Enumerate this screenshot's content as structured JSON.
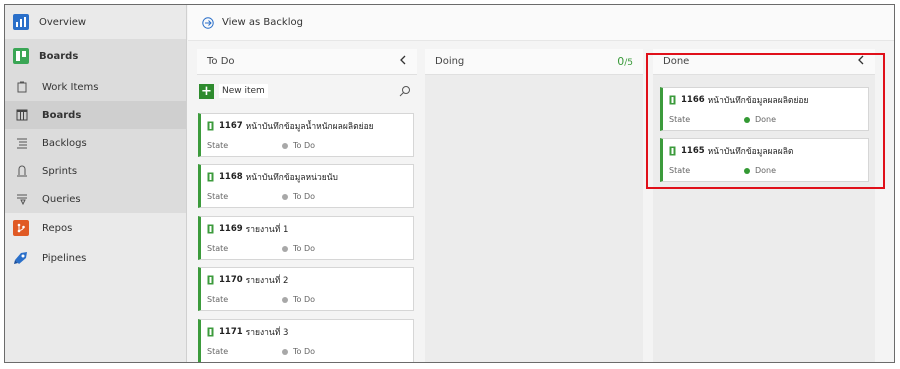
{
  "sidebar": {
    "items": [
      {
        "label": "Overview"
      },
      {
        "label": "Boards"
      },
      {
        "label": "Work Items"
      },
      {
        "label": "Boards"
      },
      {
        "label": "Backlogs"
      },
      {
        "label": "Sprints"
      },
      {
        "label": "Queries"
      },
      {
        "label": "Repos"
      },
      {
        "label": "Pipelines"
      }
    ]
  },
  "topbar": {
    "view_backlog": "View as Backlog"
  },
  "columns": {
    "todo": {
      "title": "To Do",
      "new_item": "New item"
    },
    "doing": {
      "title": "Doing",
      "wip": "0",
      "wip_limit": "/5"
    },
    "done": {
      "title": "Done"
    }
  },
  "cards": {
    "todo": [
      {
        "id": "1167",
        "title": "หน้าบันทึกข้อมูลน้ำหนักผลผลิตย่อย",
        "state_label": "State",
        "state": "To Do"
      },
      {
        "id": "1168",
        "title": "หน้าบันทึกข้อมูลหน่วยนับ",
        "state_label": "State",
        "state": "To Do"
      },
      {
        "id": "1169",
        "title": "รายงานที่ 1",
        "state_label": "State",
        "state": "To Do"
      },
      {
        "id": "1170",
        "title": "รายงานที่ 2",
        "state_label": "State",
        "state": "To Do"
      },
      {
        "id": "1171",
        "title": "รายงานที่ 3",
        "state_label": "State",
        "state": "To Do"
      }
    ],
    "done": [
      {
        "id": "1166",
        "title": "หน้าบันทึกข้อมูลผลผลิตย่อย",
        "state_label": "State",
        "state": "Done"
      },
      {
        "id": "1165",
        "title": "หน้าบันทึกข้อมูลผลผลิต",
        "state_label": "State",
        "state": "Done"
      }
    ]
  },
  "colors": {
    "accent_green": "#3c9b3c",
    "highlight_red": "#e0101a",
    "todo_dot": "#a8a8a8",
    "done_dot": "#339933"
  }
}
